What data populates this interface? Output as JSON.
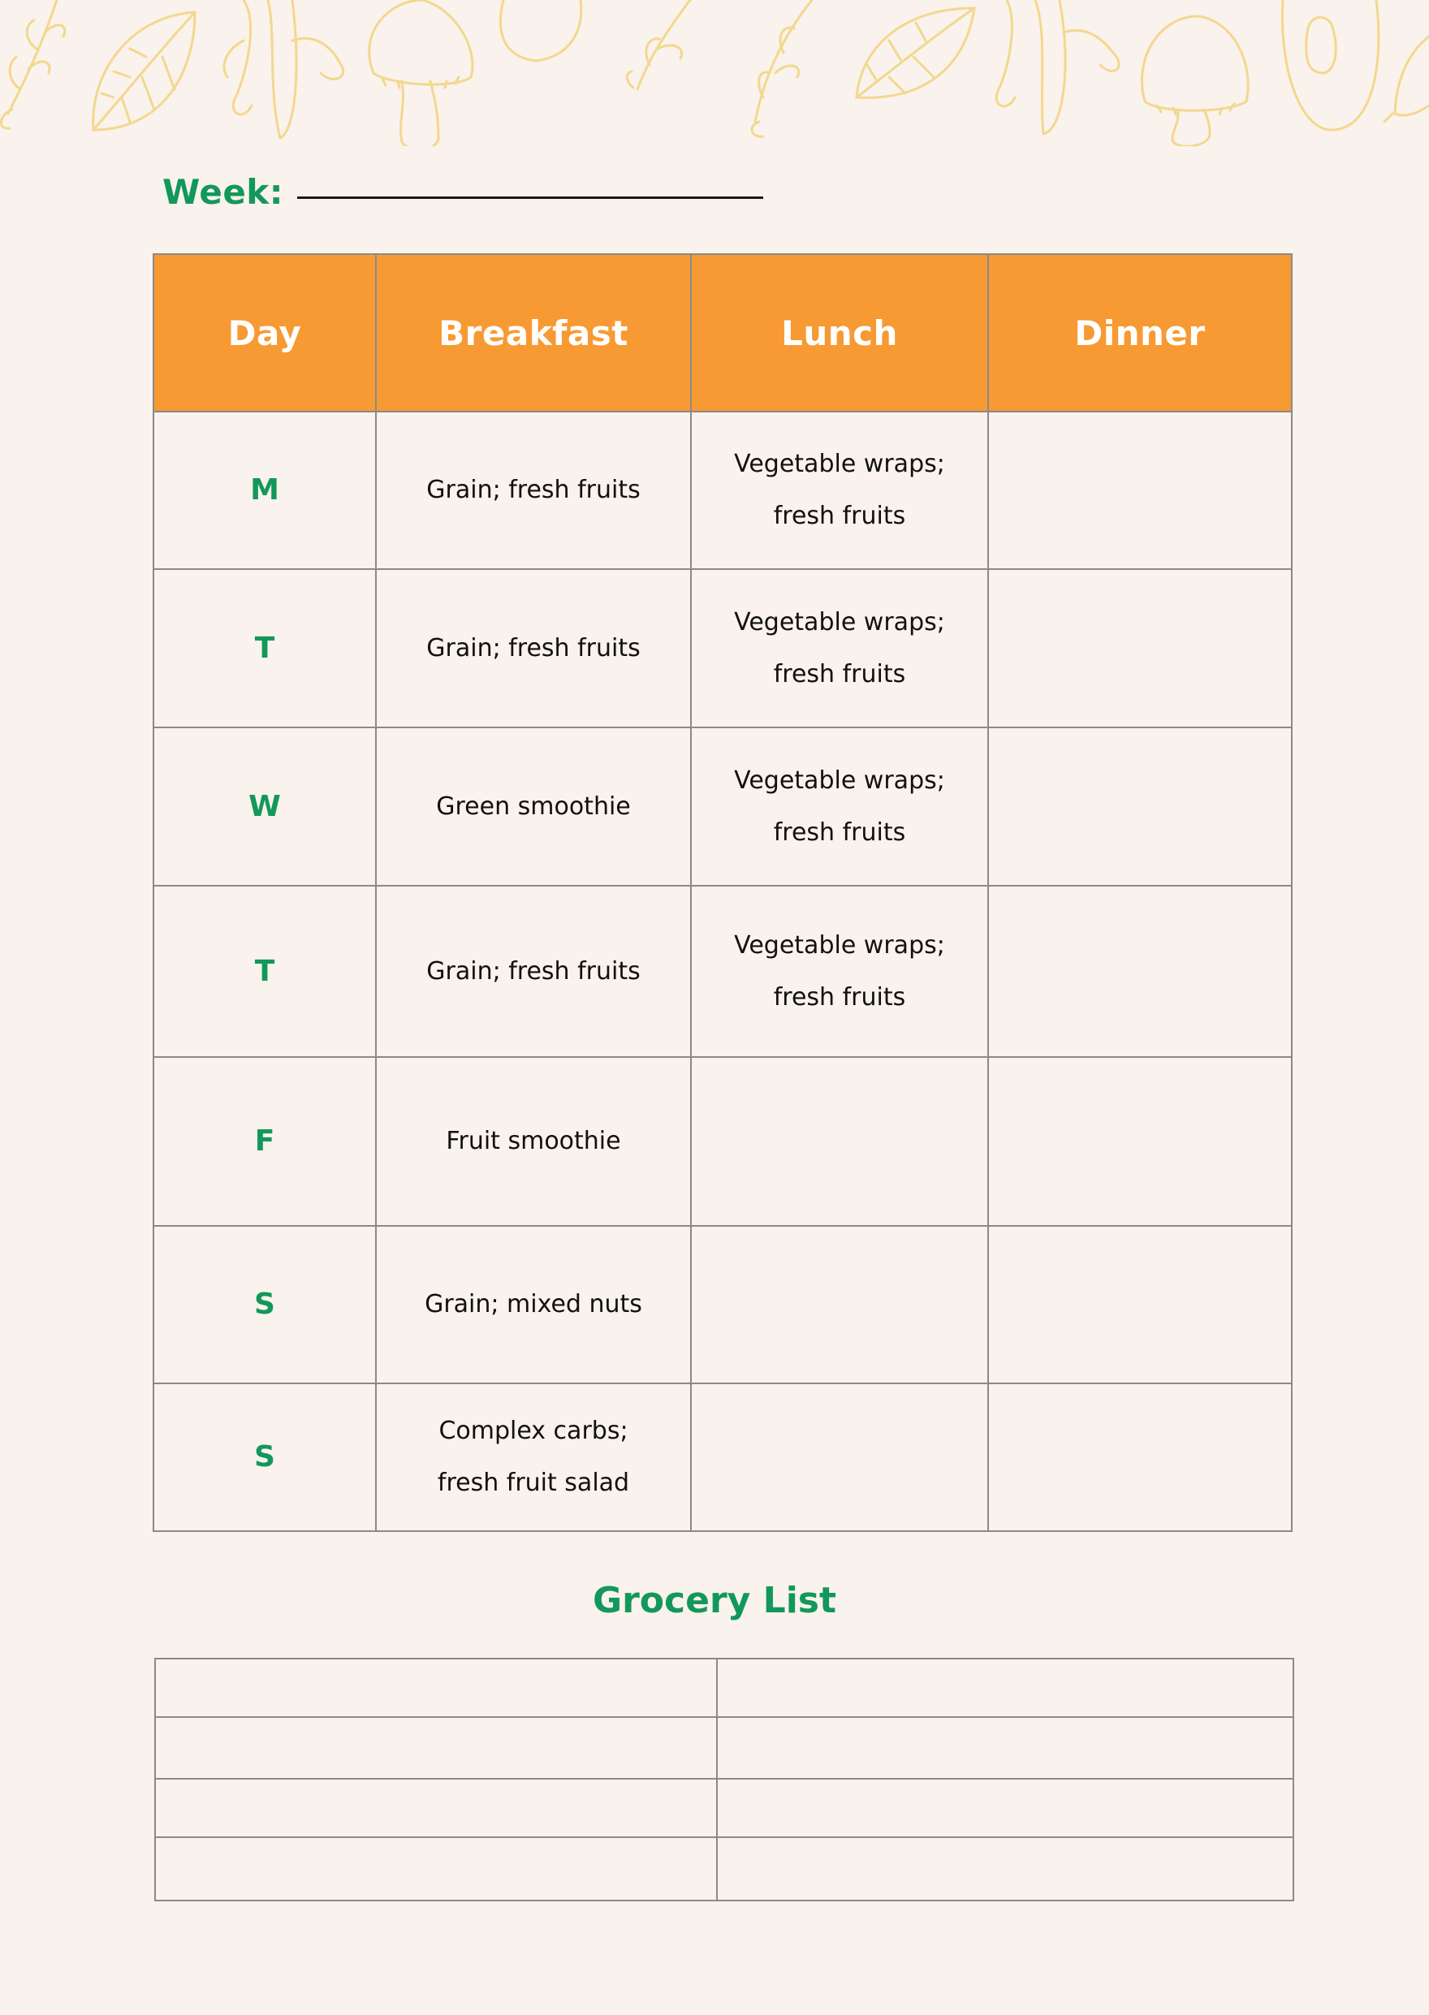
{
  "page": {
    "background_color": "#FAF2EC",
    "accent_green": "#12985A",
    "header_orange": "#F79A33",
    "decoration_color": "#F2D88F"
  },
  "decoration": {
    "icons": [
      "branch-icon",
      "leaf-icon",
      "banana-icon",
      "mushroom-icon",
      "egg-icon",
      "branch-icon",
      "leaf-icon",
      "banana-icon",
      "mushroom-icon",
      "egg-icon",
      "leaf-icon"
    ]
  },
  "week": {
    "label": "Week:",
    "value": ""
  },
  "meal_plan": {
    "headers": [
      "Day",
      "Breakfast",
      "Lunch",
      "Dinner"
    ],
    "rows": [
      {
        "day": "M",
        "breakfast": [
          "Grain; fresh fruits"
        ],
        "lunch": [
          "Vegetable wraps;",
          "fresh fruits"
        ],
        "dinner": []
      },
      {
        "day": "T",
        "breakfast": [
          "Grain; fresh fruits"
        ],
        "lunch": [
          "Vegetable wraps;",
          "fresh fruits"
        ],
        "dinner": []
      },
      {
        "day": "W",
        "breakfast": [
          "Green smoothie"
        ],
        "lunch": [
          "Vegetable wraps;",
          "fresh fruits"
        ],
        "dinner": []
      },
      {
        "day": "T",
        "breakfast": [
          "Grain; fresh fruits"
        ],
        "lunch": [
          "Vegetable wraps;",
          "fresh fruits"
        ],
        "dinner": []
      },
      {
        "day": "F",
        "breakfast": [
          "Fruit smoothie"
        ],
        "lunch": [],
        "dinner": []
      },
      {
        "day": "S",
        "breakfast": [
          "Grain; mixed nuts"
        ],
        "lunch": [],
        "dinner": []
      },
      {
        "day": "S",
        "breakfast": [
          "Complex carbs;",
          "fresh fruit salad"
        ],
        "lunch": [],
        "dinner": []
      }
    ]
  },
  "grocery": {
    "title": "Grocery List",
    "rows": [
      [
        "",
        ""
      ],
      [
        "",
        ""
      ],
      [
        "",
        ""
      ],
      [
        "",
        ""
      ]
    ]
  }
}
